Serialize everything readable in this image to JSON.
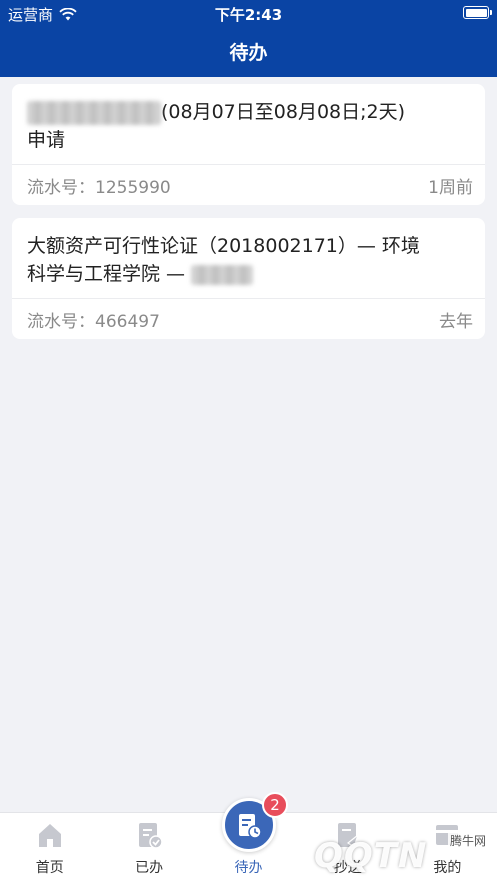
{
  "status_bar": {
    "carrier": "运营商",
    "time": "下午2:43"
  },
  "nav": {
    "title": "待办"
  },
  "items": [
    {
      "title_line1": "(08月07日至08月08日;2天)",
      "title_line2": "申请",
      "serial_label": "流水号：",
      "serial_value": "1255990",
      "time_ago": "1周前"
    },
    {
      "title_line1": "大额资产可行性论证（2018002171）— 环境",
      "title_line2": "科学与工程学院 —",
      "serial_label": "流水号：",
      "serial_value": "466497",
      "time_ago": "去年"
    }
  ],
  "tabs": [
    {
      "label": "首页",
      "icon": "home-icon"
    },
    {
      "label": "已办",
      "icon": "done-doc-icon"
    },
    {
      "label": "待办",
      "icon": "todo-doc-clock-icon"
    },
    {
      "label": "抄送",
      "icon": "cc-doc-icon"
    },
    {
      "label": "我的",
      "icon": "profile-card-icon"
    }
  ],
  "badge_count": "2",
  "watermark": {
    "big": "QQTN",
    "small": "腾牛网"
  },
  "colors": {
    "brand_blue": "#0a44a4",
    "tab_active": "#3b67b8",
    "badge_red": "#e84d5b"
  }
}
